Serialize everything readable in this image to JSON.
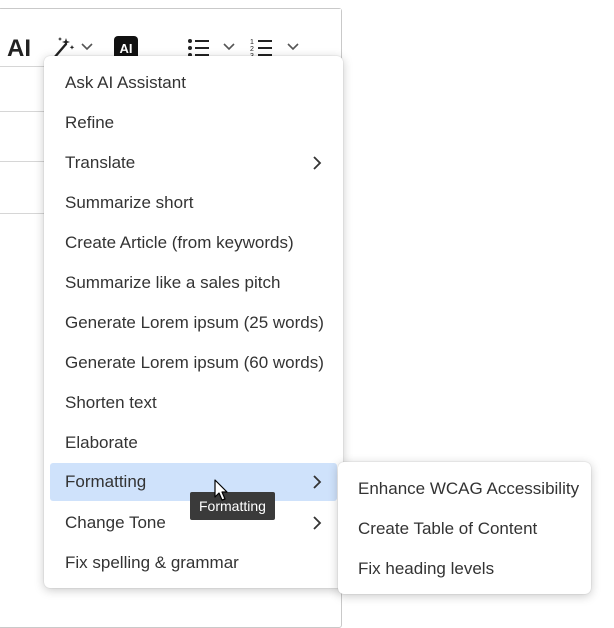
{
  "toolbar": {
    "ai_text": "AI",
    "ai_badge": "AI",
    "icons": [
      "magic-wand-icon",
      "chevron-down-icon",
      "ai-badge-icon",
      "bulleted-list-icon",
      "numbered-list-icon"
    ]
  },
  "menu": {
    "items": [
      {
        "label": "Ask AI Assistant"
      },
      {
        "label": "Refine"
      },
      {
        "label": "Translate",
        "has_submenu": true
      },
      {
        "label": "Summarize short"
      },
      {
        "label": "Create Article (from keywords)"
      },
      {
        "label": "Summarize like a sales pitch"
      },
      {
        "label": "Generate Lorem ipsum (25 words)"
      },
      {
        "label": "Generate Lorem ipsum (60 words)"
      },
      {
        "label": "Shorten text"
      },
      {
        "label": "Elaborate"
      },
      {
        "label": "Formatting",
        "has_submenu": true,
        "active": true
      },
      {
        "label": "Change Tone",
        "has_submenu": true
      },
      {
        "label": "Fix spelling & grammar"
      }
    ]
  },
  "submenu": {
    "items": [
      {
        "label": "Enhance WCAG Accessibility"
      },
      {
        "label": "Create Table of Content"
      },
      {
        "label": "Fix heading levels"
      }
    ]
  },
  "tooltip": {
    "text": "Formatting"
  },
  "colors": {
    "active_item_bg": "#cfe2fb",
    "tooltip_bg": "#3a3a3a",
    "ai_badge_bg": "#111111"
  }
}
